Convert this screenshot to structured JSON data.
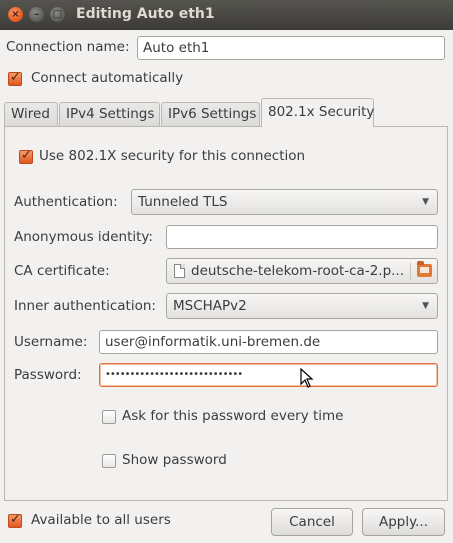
{
  "window": {
    "title": "Editing Auto eth1"
  },
  "titlebar_buttons": {
    "close": "×",
    "minimize": "–",
    "maximize": "□"
  },
  "connection": {
    "name_label": "Connection name:",
    "name_value": "Auto eth1",
    "connect_auto_label": "Connect automatically",
    "connect_auto_checked": true
  },
  "tabs": [
    {
      "label": "Wired",
      "active": false
    },
    {
      "label": "IPv4 Settings",
      "active": false
    },
    {
      "label": "IPv6 Settings",
      "active": false
    },
    {
      "label": "802.1x Security",
      "active": true
    }
  ],
  "security": {
    "use_8021x_label": "Use 802.1X security for this connection",
    "use_8021x_checked": true,
    "authentication_label": "Authentication:",
    "authentication_value": "Tunneled TLS",
    "anonymous_identity_label": "Anonymous identity:",
    "anonymous_identity_value": "",
    "ca_certificate_label": "CA certificate:",
    "ca_certificate_value": "deutsche-telekom-root-ca-2.p...",
    "inner_auth_label": "Inner authentication:",
    "inner_auth_value": "MSCHAPv2",
    "username_label": "Username:",
    "username_value": "user@informatik.uni-bremen.de",
    "password_label": "Password:",
    "password_value": "••••••••••••••••••••••••••••",
    "ask_password_label": "Ask for this password every time",
    "ask_password_checked": false,
    "show_password_label": "Show password",
    "show_password_checked": false
  },
  "footer": {
    "available_all_users_label": "Available to all users",
    "available_all_users_checked": true,
    "cancel_label": "Cancel",
    "apply_label": "Apply..."
  },
  "colors": {
    "accent": "#e0571e",
    "titlebar": "#3c3b37",
    "window_bg": "#f2f1f0"
  }
}
